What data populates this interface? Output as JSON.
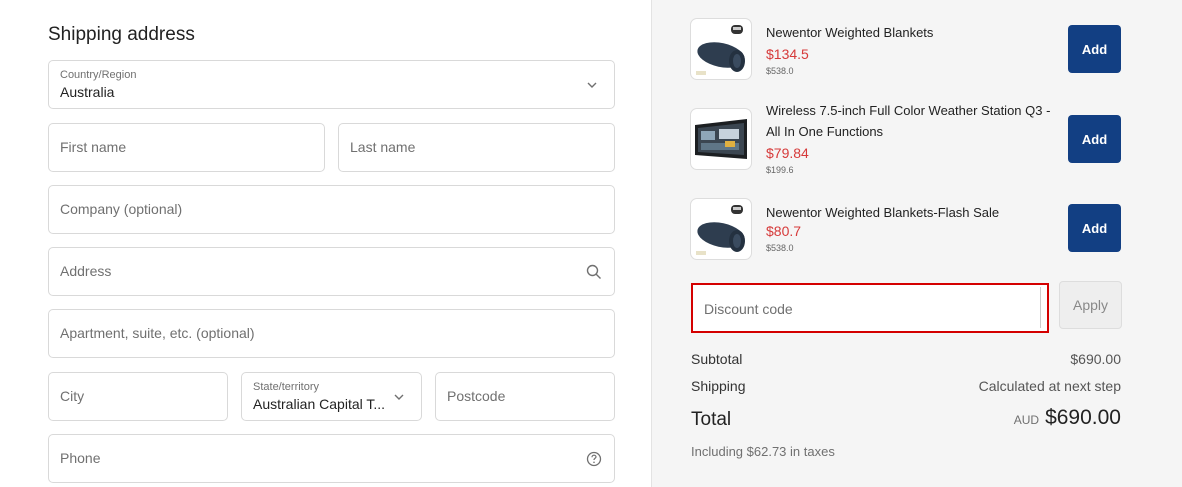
{
  "shipping": {
    "title": "Shipping address",
    "country": {
      "label": "Country/Region",
      "value": "Australia"
    },
    "first_name": {
      "placeholder": "First name"
    },
    "last_name": {
      "placeholder": "Last name"
    },
    "company": {
      "placeholder": "Company (optional)"
    },
    "address": {
      "placeholder": "Address"
    },
    "apartment": {
      "placeholder": "Apartment, suite, etc. (optional)"
    },
    "city": {
      "placeholder": "City"
    },
    "state": {
      "label": "State/territory",
      "value": "Australian Capital T..."
    },
    "postcode": {
      "placeholder": "Postcode"
    },
    "phone": {
      "placeholder": "Phone"
    }
  },
  "products": [
    {
      "name": "Newentor Weighted Blankets",
      "price": "$134.5",
      "original_price": "$538.0",
      "button": "Add",
      "icon": "blanket-thumbnail"
    },
    {
      "name": "Wireless 7.5-inch Full Color Weather Station Q3 - All In One Functions",
      "price": "$79.84",
      "original_price": "$199.6",
      "button": "Add",
      "icon": "weather-station-thumbnail"
    },
    {
      "name": "Newentor Weighted Blankets-Flash Sale",
      "price": "$80.7",
      "original_price": "$538.0",
      "button": "Add",
      "icon": "blanket-thumbnail"
    }
  ],
  "discount": {
    "placeholder": "Discount code",
    "button": "Apply"
  },
  "summary": {
    "subtotal_label": "Subtotal",
    "subtotal_value": "$690.00",
    "shipping_label": "Shipping",
    "shipping_value": "Calculated at next step",
    "total_label": "Total",
    "total_currency": "AUD",
    "total_value": "$690.00",
    "taxes_note": "Including $62.73 in taxes"
  },
  "colors": {
    "accent": "#123f83",
    "sale_price": "#d63a3a",
    "highlight_border": "#d40000"
  }
}
